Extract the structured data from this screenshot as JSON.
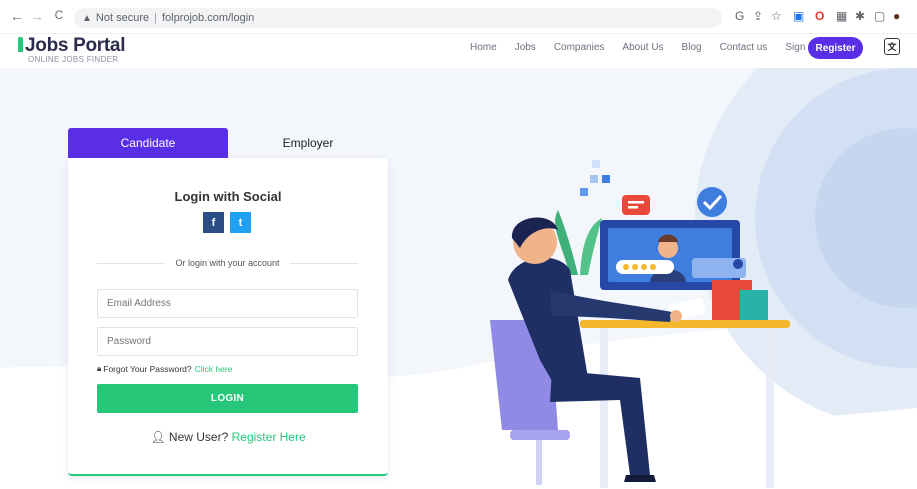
{
  "browser": {
    "back": "←",
    "forward": "→",
    "reload": "C",
    "security": "Not secure",
    "url": "folprojob.com/login",
    "ext_labels": [
      "G",
      "⇪",
      "☆",
      "▣",
      "O",
      "▦",
      "✱",
      "▢",
      "●"
    ]
  },
  "header": {
    "logo_title": "Jobs Portal",
    "logo_subtitle": "ONLINE JOBS FINDER",
    "menu": [
      "Home",
      "Jobs",
      "Companies",
      "About Us",
      "Blog",
      "Contact us",
      "Sign in"
    ],
    "register_label": "Register"
  },
  "tabs": {
    "candidate": "Candidate",
    "employer": "Employer"
  },
  "login": {
    "social_title": "Login with Social",
    "fb_label": "f",
    "tw_label": "t",
    "divider_text": "Or login with your account",
    "email_placeholder": "Email Address",
    "password_placeholder": "Password",
    "forgot_text": "Forgot Your Password?",
    "forgot_link": "Click here",
    "login_label": "LOGIN",
    "new_user_text": "New User?",
    "register_link": "Register Here"
  },
  "colors": {
    "brand": "#5a2ee6",
    "accent_green": "#27c77a",
    "facebook": "#2b4d86",
    "twitter": "#1ea1f2"
  }
}
